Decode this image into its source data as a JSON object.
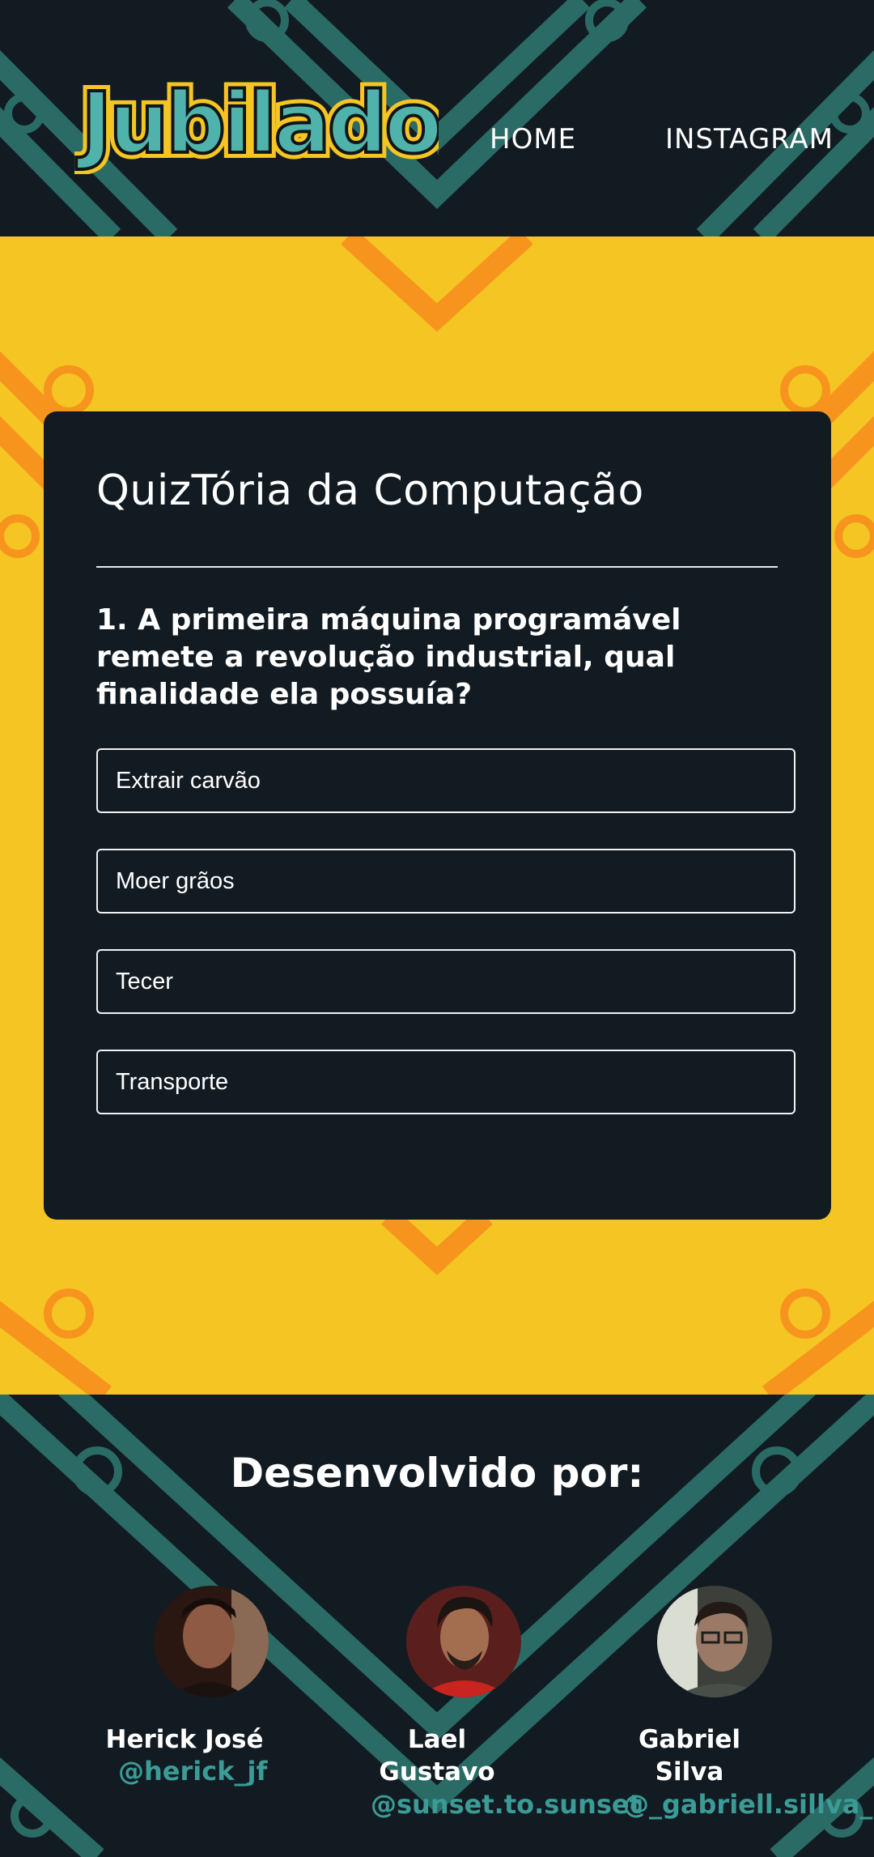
{
  "header": {
    "logo_text": "Jubilados",
    "nav": [
      {
        "label": "HOME"
      },
      {
        "label": "INSTAGRAM"
      }
    ]
  },
  "quiz": {
    "title": "QuizTória da Computação",
    "question": "1. A primeira máquina programável remete a revolução industrial, qual finalidade ela possuía?",
    "options": [
      {
        "label": "Extrair carvão"
      },
      {
        "label": "Moer grãos"
      },
      {
        "label": "Tecer"
      },
      {
        "label": "Transporte"
      }
    ]
  },
  "footer": {
    "title": "Desenvolvido por:",
    "developers": [
      {
        "name": "Herick José",
        "handle": "@herick_jf"
      },
      {
        "name": "Lael Gustavo",
        "handle": "@sunset.to.sunset"
      },
      {
        "name": "Gabriel Silva",
        "handle": "@_gabriell.sillva_"
      }
    ]
  },
  "colors": {
    "dark_background": "#121b22",
    "yellow_band": "#f4c523",
    "orange_pattern": "#f7941d",
    "teal_pattern": "#2a6b66",
    "handle_teal": "#3b9b96",
    "logo_teal": "#4fb3ac"
  },
  "icons": [
    "logo",
    "avatar"
  ]
}
